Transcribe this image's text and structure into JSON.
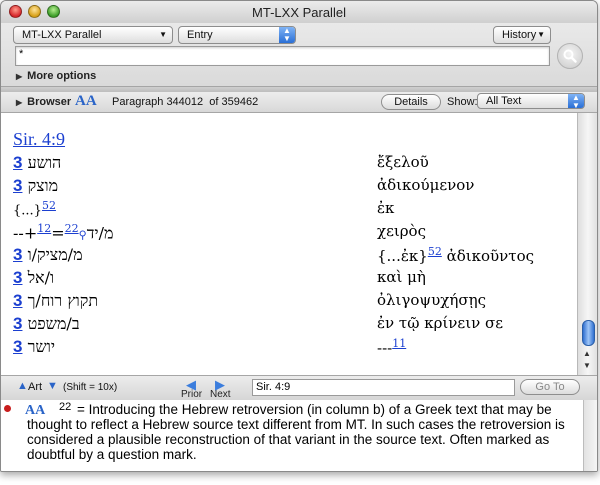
{
  "window": {
    "title": "MT-LXX Parallel"
  },
  "toolbar": {
    "module_popup": "MT-LXX Parallel",
    "field_popup": "Entry",
    "history_button": "History",
    "search_value": "*",
    "more_options": "More options"
  },
  "browser_bar": {
    "label": "Browser",
    "aa_glyph": "AA",
    "paragraph_label": "Paragraph",
    "paragraph_number": "344012",
    "of_label": "of",
    "paragraph_total": "359462",
    "details_button": "Details",
    "show_label": "Show:",
    "show_value": "All Text"
  },
  "content": {
    "reference": "Sir. 4:9",
    "rows": [
      {
        "hebrew": "הושע",
        "number": "3",
        "greek": "ἔξελοῦ"
      },
      {
        "hebrew": "מוצק",
        "number": "3",
        "greek": "ἀδικούμενον"
      },
      {
        "hebrew": "{...}",
        "footnote": "52",
        "greek": "ἐκ"
      },
      {
        "hebrew_prefix": "--+",
        "footnote": "12",
        "hebrew_mid": "=",
        "footnote2": "22",
        "hebrew": "מ/יד",
        "greek": "χειρὸς"
      },
      {
        "hebrew": "מ/מציק/ו",
        "number": "3",
        "greek_prefix": "{...ἐκ}",
        "greek_footnote": "52",
        "greek": "ἀδικοῦντος"
      },
      {
        "hebrew": "ו/אל",
        "number": "3",
        "greek": "καὶ μὴ"
      },
      {
        "hebrew": "תקוץ רוח/ך",
        "number": "3",
        "greek": "ὀλιγοψυχήσῃς"
      },
      {
        "hebrew": "ב/משפט",
        "number": "3",
        "greek": "ἐν τῷ κρίνειν σε"
      },
      {
        "hebrew": "יושר",
        "number": "3",
        "greek_prefix": "---",
        "greek_footnote": "11"
      }
    ]
  },
  "bottom_bar": {
    "art_label": "Art",
    "shift_hint": "(Shift = 10x)",
    "prior_label": "Prior",
    "next_label": "Next",
    "goto_value": "Sir. 4:9",
    "goto_button": "Go To"
  },
  "note": {
    "aa_glyph": "AA",
    "number": "22",
    "text": "=  Introducing the Hebrew retroversion (in column b) of a Greek text that may be thought to reflect a Hebrew source text different from MT. In such cases the retroversion is considered a plausible reconstruction of that variant in the source text. Often marked as doubtful by a question mark."
  },
  "colors": {
    "link": "#1b3fd0",
    "accent": "#2a64c8"
  }
}
